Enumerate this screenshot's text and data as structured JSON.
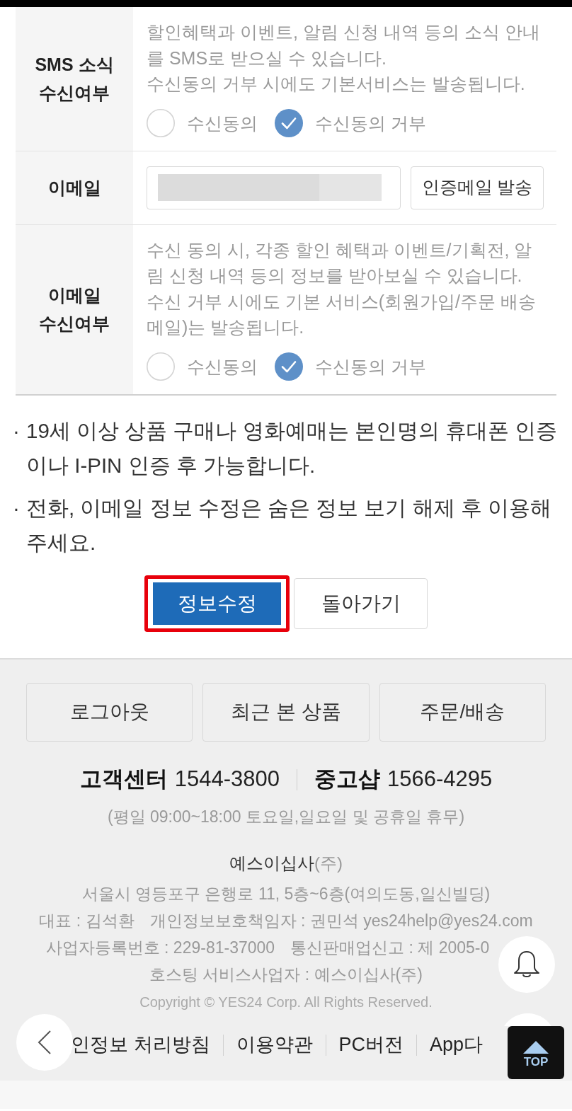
{
  "form_rows": [
    {
      "kind": "consent",
      "label": "SMS 소식 수신여부",
      "description": [
        "할인혜택과 이벤트, 알림 신청 내역 등의 소식 안내를 SMS로 받으실 수 있습니다.",
        "수신동의 거부 시에도 기본서비스는 발송됩니다."
      ],
      "options": [
        {
          "label": "수신동의",
          "selected": false
        },
        {
          "label": "수신동의 거부",
          "selected": true
        }
      ]
    },
    {
      "kind": "email",
      "label": "이메일",
      "button": "인증메일 발송"
    },
    {
      "kind": "consent",
      "label": "이메일 수신여부",
      "description": [
        "수신 동의 시, 각종 할인 혜택과 이벤트/기획전, 알림 신청 내역 등의 정보를 받아보실 수 있습니다.",
        "수신 거부 시에도 기본 서비스(회원가입/주문 배송메일)는 발송됩니다."
      ],
      "options": [
        {
          "label": "수신동의",
          "selected": false
        },
        {
          "label": "수신동의 거부",
          "selected": true
        }
      ]
    }
  ],
  "notes": [
    {
      "bullet": "·",
      "text": "19세 이상 상품 구매나 영화예매는 본인명의 휴대폰 인증이나 I-PIN 인증 후 가능합니다."
    },
    {
      "bullet": "·",
      "text": "전화, 이메일 정보 수정은 숨은 정보 보기 해제 후 이용해주세요."
    }
  ],
  "actions": [
    {
      "kind": "primary",
      "label": "정보수정",
      "highlighted": true
    },
    {
      "kind": "secondary",
      "label": "돌아가기",
      "highlighted": false
    }
  ],
  "footer": {
    "buttons": [
      "로그아웃",
      "최근 본 상품",
      "주문/배송"
    ],
    "phones": [
      {
        "label": "고객센터",
        "number": "1544-3800"
      },
      {
        "label": "중고샵",
        "number": "1566-4295"
      }
    ],
    "hours": "(평일 09:00~18:00 토요일,일요일 및 공휴일 휴무)",
    "company": {
      "name": "예스이십사",
      "suffix": "(주)"
    },
    "info_lines": [
      [
        "서울시 영등포구 은행로 11, 5층~6층(여의도동,일신빌딩)"
      ],
      [
        "대표 : 김석환",
        "개인정보보호책임자 : 권민석 yes24help@yes24.com"
      ],
      [
        "사업자등록번호 : 229-81-37000",
        "통신판매업신고 : 제 2005-0"
      ],
      [
        "호스팅 서비스사업자 : 예스이십사(주)"
      ]
    ],
    "copyright": "Copyright © YES24 Corp. All Rights Reserved.",
    "links": [
      "인정보 처리방침",
      "이용약관",
      "PC버전",
      "App다"
    ]
  },
  "floating": {
    "top_label": "TOP"
  }
}
